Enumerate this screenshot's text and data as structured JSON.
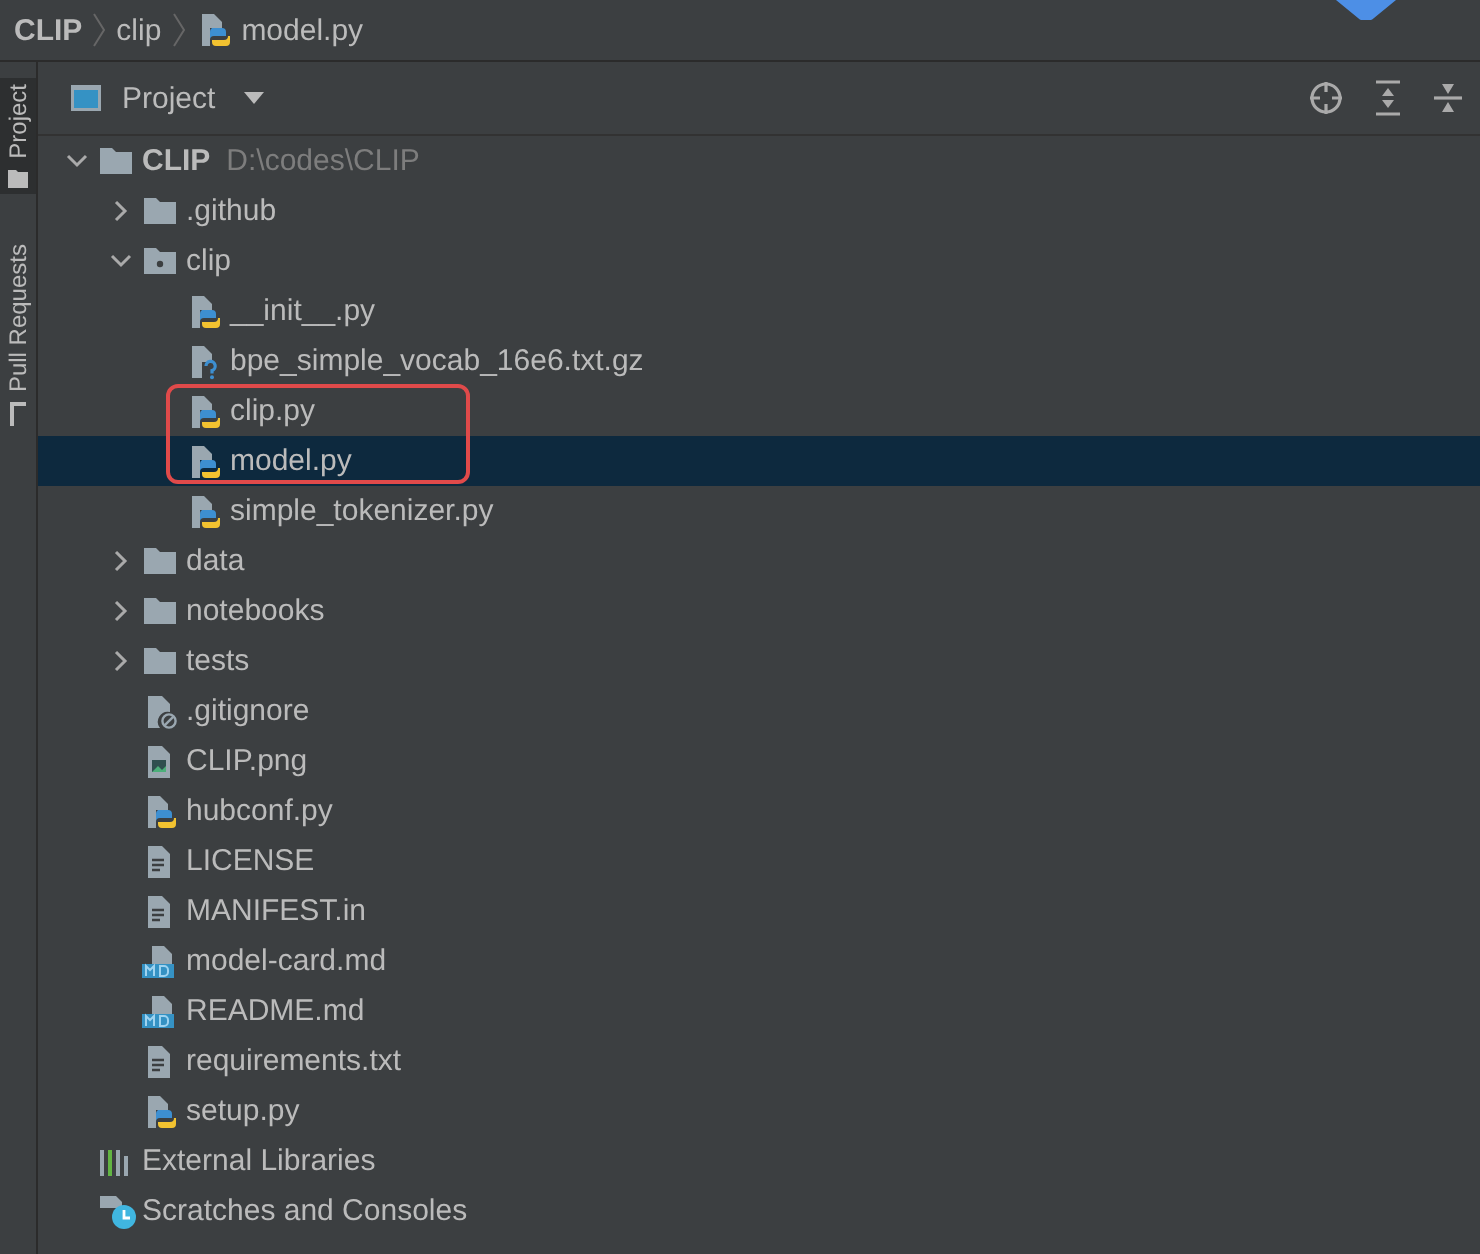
{
  "breadcrumb": [
    {
      "label": "CLIP",
      "kind": "root"
    },
    {
      "label": "clip",
      "kind": "folder"
    },
    {
      "label": "model.py",
      "kind": "python"
    }
  ],
  "side_tabs": [
    {
      "label": "Project",
      "kind": "project",
      "selected": true
    },
    {
      "label": "Pull Requests",
      "kind": "pull",
      "selected": false
    }
  ],
  "panel": {
    "title": "Project"
  },
  "tree": [
    {
      "label": "CLIP",
      "path": "D:\\codes\\CLIP",
      "kind": "root",
      "expanded": true,
      "selected": false,
      "marked": false,
      "children": [
        {
          "label": ".github",
          "kind": "folder",
          "expanded": false,
          "selected": false,
          "marked": false
        },
        {
          "label": "clip",
          "kind": "package",
          "expanded": true,
          "selected": false,
          "marked": false,
          "children": [
            {
              "label": "__init__.py",
              "kind": "python",
              "selected": false,
              "marked": false
            },
            {
              "label": "bpe_simple_vocab_16e6.txt.gz",
              "kind": "archive",
              "selected": false,
              "marked": false
            },
            {
              "label": "clip.py",
              "kind": "python",
              "selected": false,
              "marked": true
            },
            {
              "label": "model.py",
              "kind": "python",
              "selected": true,
              "marked": true
            },
            {
              "label": "simple_tokenizer.py",
              "kind": "python",
              "selected": false,
              "marked": false
            }
          ]
        },
        {
          "label": "data",
          "kind": "folder",
          "expanded": false,
          "selected": false,
          "marked": false
        },
        {
          "label": "notebooks",
          "kind": "folder",
          "expanded": false,
          "selected": false,
          "marked": false
        },
        {
          "label": "tests",
          "kind": "folder",
          "expanded": false,
          "selected": false,
          "marked": false
        },
        {
          "label": ".gitignore",
          "kind": "ignore",
          "selected": false,
          "marked": false
        },
        {
          "label": "CLIP.png",
          "kind": "image",
          "selected": false,
          "marked": false
        },
        {
          "label": "hubconf.py",
          "kind": "python",
          "selected": false,
          "marked": false
        },
        {
          "label": "LICENSE",
          "kind": "text",
          "selected": false,
          "marked": false
        },
        {
          "label": "MANIFEST.in",
          "kind": "text",
          "selected": false,
          "marked": false
        },
        {
          "label": "model-card.md",
          "kind": "markdown",
          "selected": false,
          "marked": false
        },
        {
          "label": "README.md",
          "kind": "markdown",
          "selected": false,
          "marked": false
        },
        {
          "label": "requirements.txt",
          "kind": "text",
          "selected": false,
          "marked": false
        },
        {
          "label": "setup.py",
          "kind": "python",
          "selected": false,
          "marked": false
        }
      ]
    },
    {
      "label": "External Libraries",
      "kind": "libraries",
      "selected": false,
      "marked": false
    },
    {
      "label": "Scratches and Consoles",
      "kind": "scratches",
      "selected": false,
      "marked": false
    }
  ]
}
